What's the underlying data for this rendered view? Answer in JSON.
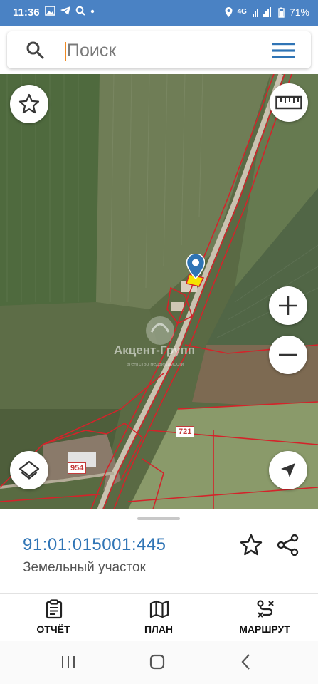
{
  "status_bar": {
    "time": "11:36",
    "network_label": "4G",
    "battery": "71%"
  },
  "search": {
    "placeholder": "Поиск"
  },
  "map": {
    "watermark": "Акцент-Групп",
    "watermark_sub": "агентство недвижимости",
    "road_labels": [
      "721",
      "954"
    ]
  },
  "parcel": {
    "cadastral_number": "91:01:015001:445",
    "type": "Земельный участок"
  },
  "actions": [
    {
      "label": "ОТЧЁТ",
      "icon": "report-icon"
    },
    {
      "label": "ПЛАН",
      "icon": "map-plan-icon"
    },
    {
      "label": "МАРШРУТ",
      "icon": "route-icon"
    }
  ],
  "colors": {
    "status_bar": "#4a82c4",
    "accent_blue": "#2f74b5",
    "cadastre_line": "#d4232a",
    "highlight_yellow": "#f5e400"
  }
}
